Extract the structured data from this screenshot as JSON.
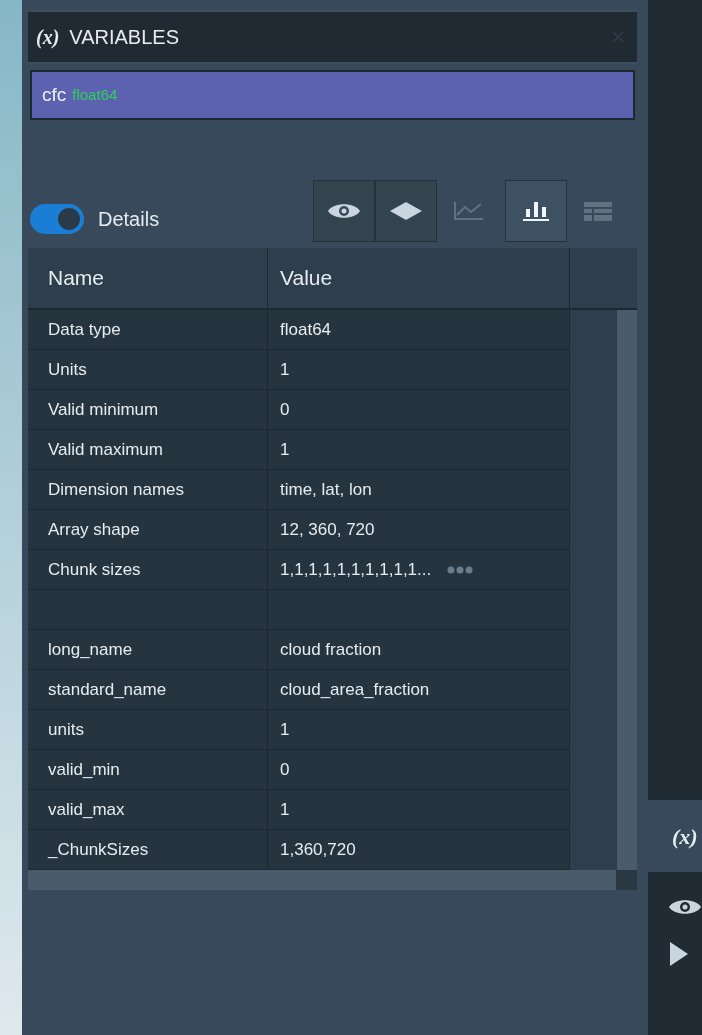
{
  "panel": {
    "title": "VARIABLES",
    "title_icon": "(x)"
  },
  "variables": [
    {
      "name": "cfc",
      "type": "float64",
      "selected": true
    }
  ],
  "details_toggle": {
    "label": "Details",
    "on": true
  },
  "toolbar": [
    {
      "kind": "eye",
      "selected": false,
      "disabled": false
    },
    {
      "kind": "diamond",
      "selected": false,
      "disabled": false
    },
    {
      "kind": "line-chart",
      "disabled": true
    },
    {
      "kind": "bar-chart",
      "selected": true,
      "disabled": false
    },
    {
      "kind": "table",
      "disabled": true
    }
  ],
  "table": {
    "columns": [
      "Name",
      "Value"
    ],
    "rows": [
      {
        "name": "Data type",
        "value": "float64"
      },
      {
        "name": "Units",
        "value": "1"
      },
      {
        "name": "Valid minimum",
        "value": "0"
      },
      {
        "name": "Valid maximum",
        "value": "1"
      },
      {
        "name": "Dimension names",
        "value": "time, lat, lon"
      },
      {
        "name": "Array shape",
        "value": "12, 360, 720"
      },
      {
        "name": "Chunk sizes",
        "value": "1,1,1,1,1,1,1,1,1,1...",
        "more": true
      },
      {
        "name": "",
        "value": ""
      },
      {
        "name": "long_name",
        "value": "cloud fraction"
      },
      {
        "name": "standard_name",
        "value": "cloud_area_fraction"
      },
      {
        "name": "units",
        "value": "1"
      },
      {
        "name": "valid_min",
        "value": "0"
      },
      {
        "name": "valid_max",
        "value": "1"
      },
      {
        "name": "_ChunkSizes",
        "value": "1,360,720"
      }
    ]
  },
  "side_strip": {
    "tab_label": "(x)"
  }
}
